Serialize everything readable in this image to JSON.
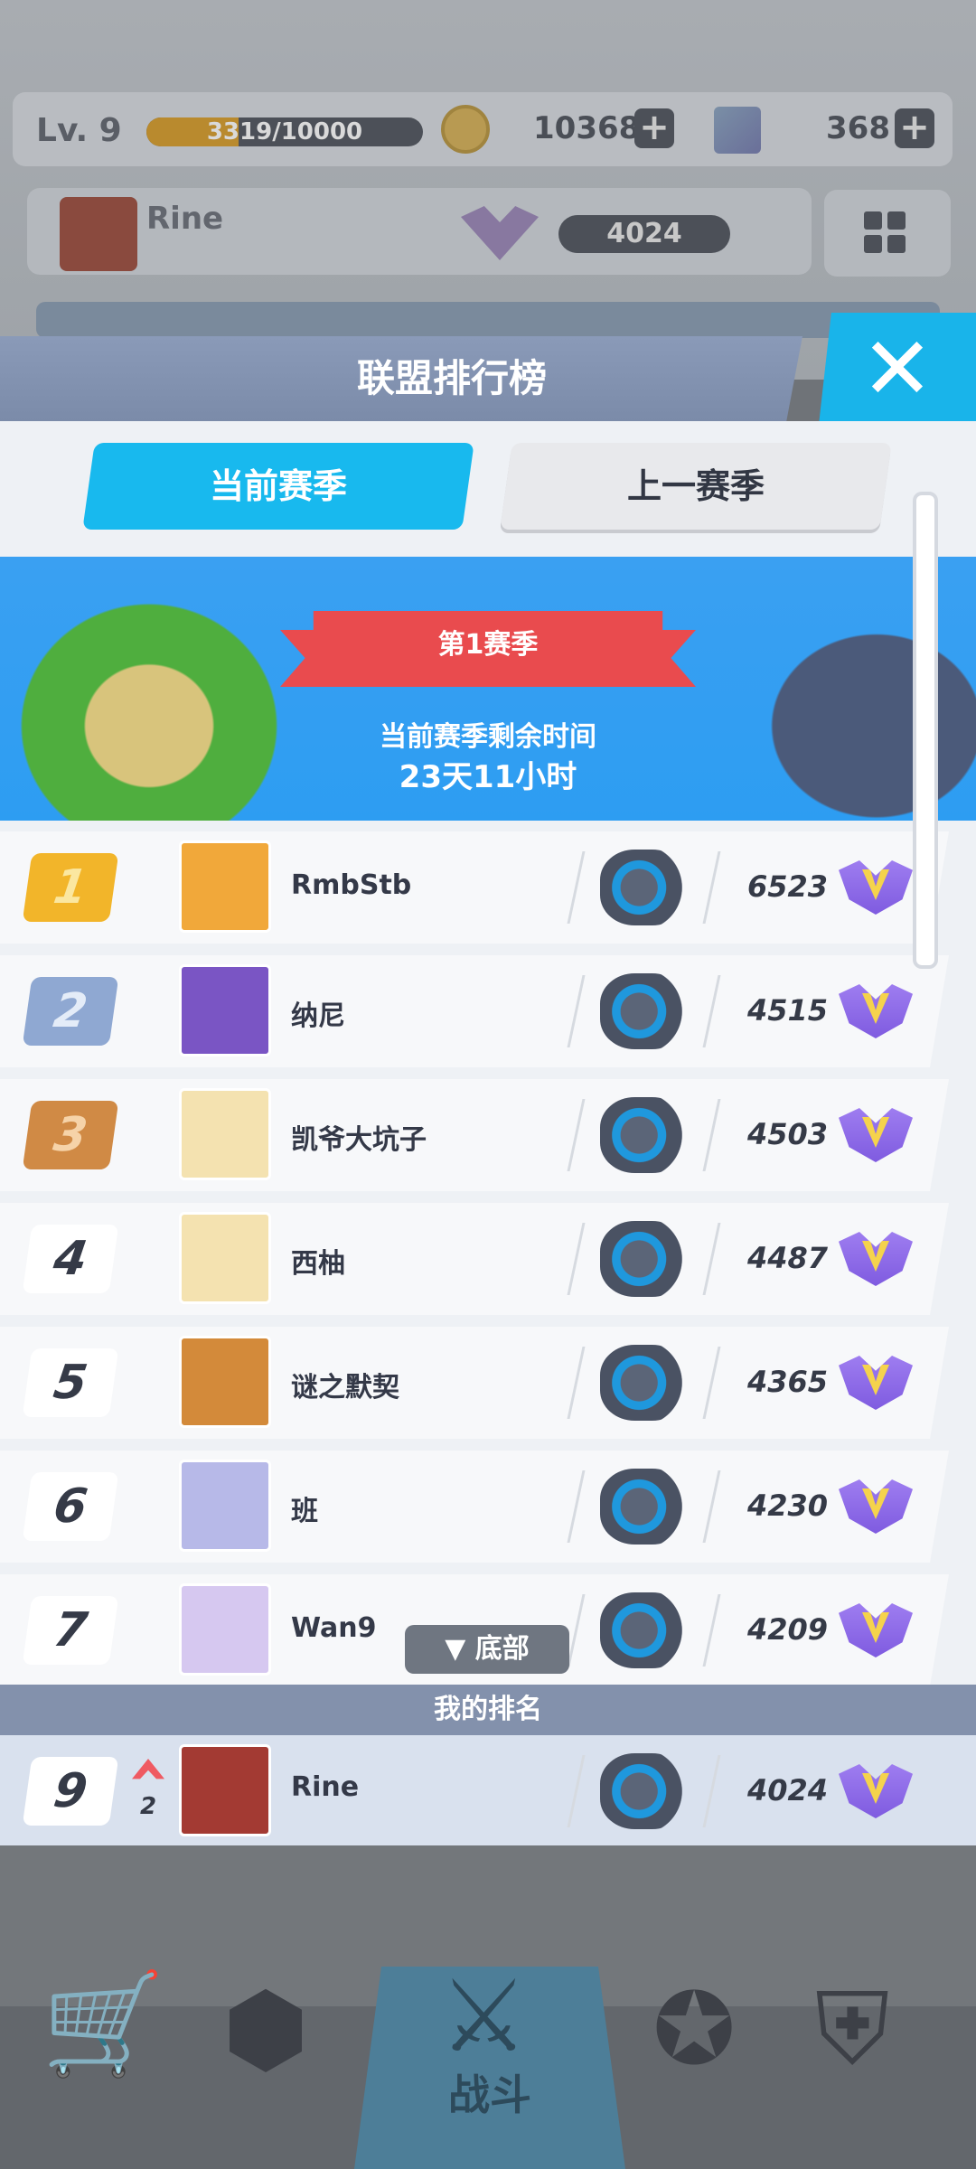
{
  "hud": {
    "level": "Lv. 9",
    "xp_text": "3319/10000",
    "xp_progress": 0.3319,
    "coins": "10368",
    "gems": "368",
    "player_name": "Rine",
    "player_score": "4024"
  },
  "modal": {
    "title": "联盟排行榜",
    "tabs": [
      {
        "label": "当前赛季",
        "active": true
      },
      {
        "label": "上一赛季",
        "active": false
      }
    ],
    "season": {
      "name": "第1赛季",
      "remain_label": "当前赛季剩余时间",
      "remain_time": "23天11小时"
    },
    "rows": [
      {
        "rank": "1",
        "name": "RmbStb",
        "score": "6523"
      },
      {
        "rank": "2",
        "name": "纳尼",
        "score": "4515"
      },
      {
        "rank": "3",
        "name": "凯爷大坑子",
        "score": "4503"
      },
      {
        "rank": "4",
        "name": "西柚",
        "score": "4487"
      },
      {
        "rank": "5",
        "name": "谜之默契",
        "score": "4365"
      },
      {
        "rank": "6",
        "name": "班",
        "score": "4230"
      },
      {
        "rank": "7",
        "name": "Wan9",
        "score": "4209"
      }
    ],
    "bottom_button": "▼ 底部",
    "my_rank_label": "我的排名",
    "my_rank": {
      "rank": "9",
      "change": "2",
      "name": "Rine",
      "score": "4024"
    }
  },
  "nav": {
    "battle_label": "战斗"
  },
  "colors": {
    "accent": "#18b9ee",
    "gold": "#f2b52a",
    "silver": "#8fa8d2",
    "bronze": "#d08a45",
    "rank_up": "#ef5a62"
  }
}
